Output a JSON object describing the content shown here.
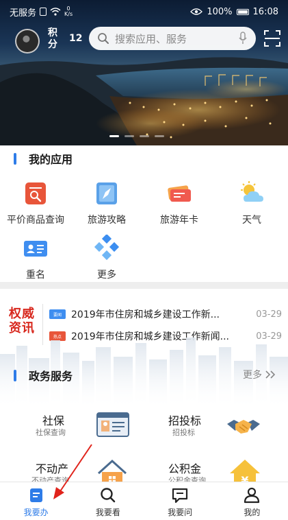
{
  "status_bar": {
    "carrier": "无服务",
    "speed_value": "0",
    "speed_unit": "K/s",
    "battery": "100%",
    "time": "16:08"
  },
  "header": {
    "points_label": "积分",
    "points_value": "12",
    "search_placeholder": "搜索应用、服务"
  },
  "banner": {
    "slide_count": 4,
    "active_slide": 1
  },
  "my_apps": {
    "title": "我的应用",
    "items": [
      {
        "label": "平价商品查询",
        "icon": "document-search-icon",
        "color": "#e8553a"
      },
      {
        "label": "旅游攻略",
        "icon": "compass-icon",
        "color": "#5aa1e8"
      },
      {
        "label": "旅游年卡",
        "icon": "ticket-icon",
        "color": "#f05a4f"
      },
      {
        "label": "天气",
        "icon": "weather-icon",
        "color": "#f5c43a"
      },
      {
        "label": "重名",
        "icon": "id-card-icon",
        "color": "#3f8ef0"
      },
      {
        "label": "更多",
        "icon": "more-diamonds-icon",
        "color": "#3c8ef0"
      }
    ]
  },
  "news": {
    "logo_line1": "权威",
    "logo_line2": "资讯",
    "items": [
      {
        "tag": "要闻",
        "tag_color": "#3f8ef0",
        "title": "2019年市住房和城乡建设工作新...",
        "date": "03-29"
      },
      {
        "tag": "热点",
        "tag_color": "#e8553a",
        "title": "2019年市住房和城乡建设工作新闻...",
        "date": "03-29"
      }
    ]
  },
  "gov_services": {
    "title": "政务服务",
    "more_label": "更多",
    "items": [
      {
        "name": "社保",
        "sub": "社保查询",
        "icon": "id-card-icon"
      },
      {
        "name": "招投标",
        "sub": "招投标",
        "icon": "handshake-icon"
      },
      {
        "name": "不动产",
        "sub": "不动产查询",
        "icon": "house-icon"
      },
      {
        "name": "公积金",
        "sub": "公积金查询",
        "icon": "yuan-house-icon"
      }
    ]
  },
  "tab_bar": {
    "accent_color": "#2e7ce8",
    "tabs": [
      {
        "label": "我要办",
        "icon": "document-icon",
        "active": true
      },
      {
        "label": "我要看",
        "icon": "search-icon",
        "active": false
      },
      {
        "label": "我要问",
        "icon": "chat-icon",
        "active": false
      },
      {
        "label": "我的",
        "icon": "person-icon",
        "active": false
      }
    ]
  }
}
